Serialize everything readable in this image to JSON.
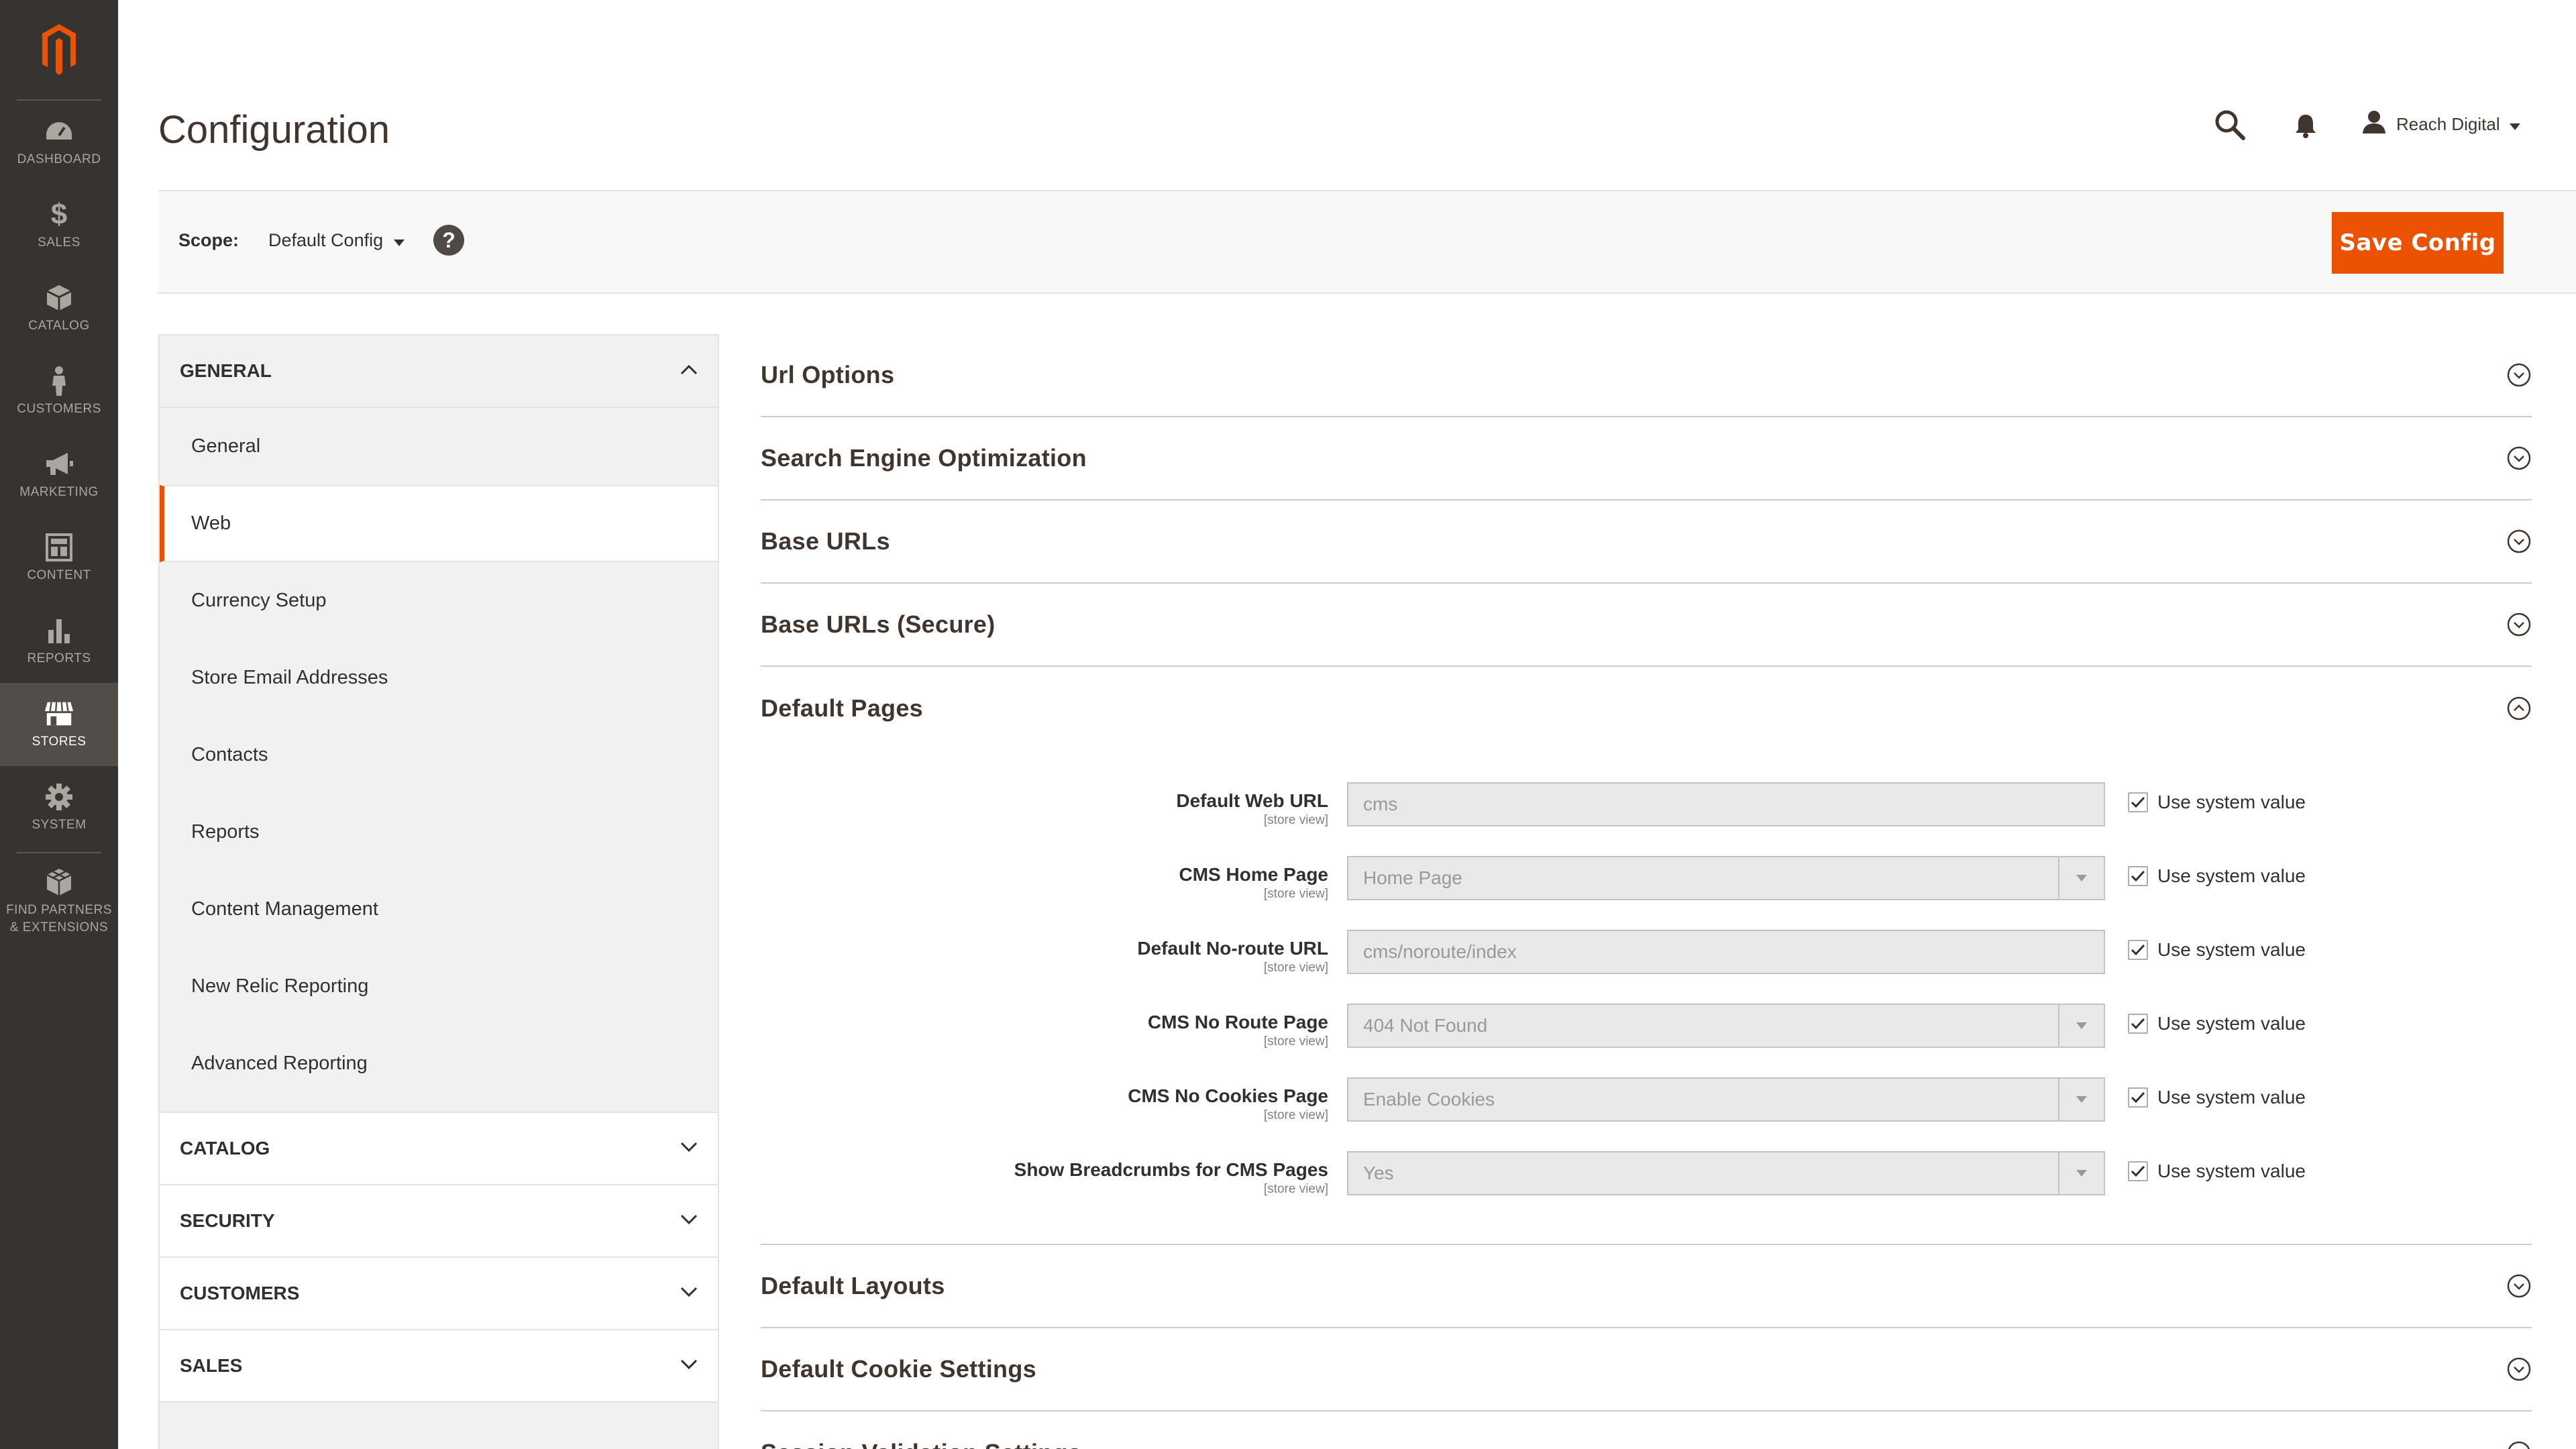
{
  "menu": {
    "items": [
      {
        "label": "DASHBOARD",
        "icon": "dashboard-icon"
      },
      {
        "label": "SALES",
        "icon": "dollar-icon"
      },
      {
        "label": "CATALOG",
        "icon": "box-icon"
      },
      {
        "label": "CUSTOMERS",
        "icon": "person-icon"
      },
      {
        "label": "MARKETING",
        "icon": "megaphone-icon"
      },
      {
        "label": "CONTENT",
        "icon": "layout-icon"
      },
      {
        "label": "REPORTS",
        "icon": "bar-chart-icon"
      },
      {
        "label": "STORES",
        "icon": "storefront-icon"
      },
      {
        "label": "SYSTEM",
        "icon": "gear-icon"
      },
      {
        "label1": "FIND PARTNERS",
        "label2": "& EXTENSIONS",
        "icon": "cubes-icon"
      }
    ]
  },
  "header": {
    "title": "Configuration",
    "user": "Reach Digital"
  },
  "scope": {
    "label": "Scope:",
    "value": "Default Config",
    "save_label": "Save Config"
  },
  "nav": {
    "general_title": "GENERAL",
    "links": [
      "General",
      "Web",
      "Currency Setup",
      "Store Email Addresses",
      "Contacts",
      "Reports",
      "Content Management",
      "New Relic Reporting",
      "Advanced Reporting"
    ],
    "active_link": "Web",
    "collapsed": [
      "CATALOG",
      "SECURITY",
      "CUSTOMERS",
      "SALES"
    ]
  },
  "groups_top": [
    "Url Options",
    "Search Engine Optimization",
    "Base URLs",
    "Base URLs (Secure)"
  ],
  "default_pages": {
    "title": "Default Pages",
    "fields": [
      {
        "label": "Default Web URL",
        "scope": "[store view]",
        "value": "cms",
        "type": "text",
        "system": "Use system value"
      },
      {
        "label": "CMS Home Page",
        "scope": "[store view]",
        "value": "Home Page",
        "type": "select",
        "system": "Use system value"
      },
      {
        "label": "Default No-route URL",
        "scope": "[store view]",
        "value": "cms/noroute/index",
        "type": "text",
        "system": "Use system value"
      },
      {
        "label": "CMS No Route Page",
        "scope": "[store view]",
        "value": "404 Not Found",
        "type": "select",
        "system": "Use system value"
      },
      {
        "label": "CMS No Cookies Page",
        "scope": "[store view]",
        "value": "Enable Cookies",
        "type": "select",
        "system": "Use system value"
      },
      {
        "label": "Show Breadcrumbs for CMS Pages",
        "scope": "[store view]",
        "value": "Yes",
        "type": "select",
        "system": "Use system value"
      }
    ]
  },
  "groups_bottom": [
    "Default Layouts",
    "Default Cookie Settings",
    "Session Validation Settings"
  ],
  "colors": {
    "accent": "#eb5202",
    "sidebar": "#373330"
  }
}
